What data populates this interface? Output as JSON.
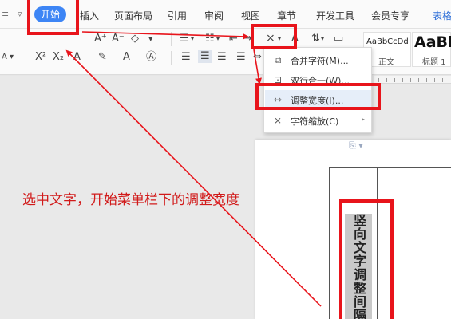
{
  "tabs": [
    {
      "label": "开始",
      "active": true
    },
    {
      "label": "插入"
    },
    {
      "label": "页面布局"
    },
    {
      "label": "引用"
    },
    {
      "label": "审阅"
    },
    {
      "label": "视图"
    },
    {
      "label": "章节"
    },
    {
      "label": "开发工具"
    },
    {
      "label": "会员专享"
    },
    {
      "label": "表格"
    }
  ],
  "ribbon": {
    "style_samples": [
      {
        "sample": "AaBbCcDd",
        "name": "正文"
      },
      {
        "sample": "AaBl",
        "name": "标题 1"
      }
    ]
  },
  "menu": {
    "items": [
      {
        "label": "合并字符(M)...",
        "icon": "combine-chars-icon",
        "highlighted": false
      },
      {
        "label": "双行合一(W)...",
        "icon": "double-line-icon",
        "highlighted": false
      },
      {
        "label": "调整宽度(I)...",
        "icon": "adjust-width-icon",
        "highlighted": true
      },
      {
        "label": "字符缩放(C)",
        "icon": "char-scale-icon",
        "highlighted": false,
        "has_submenu": true
      }
    ]
  },
  "document": {
    "vertical_text": "竖向文字调整间隔"
  },
  "annotation": {
    "text": "选中文字，开始菜单栏下的调整宽度",
    "color": "#e8141b"
  },
  "colors": {
    "accent": "#3d85f5",
    "annotation_red": "#e8141b"
  }
}
